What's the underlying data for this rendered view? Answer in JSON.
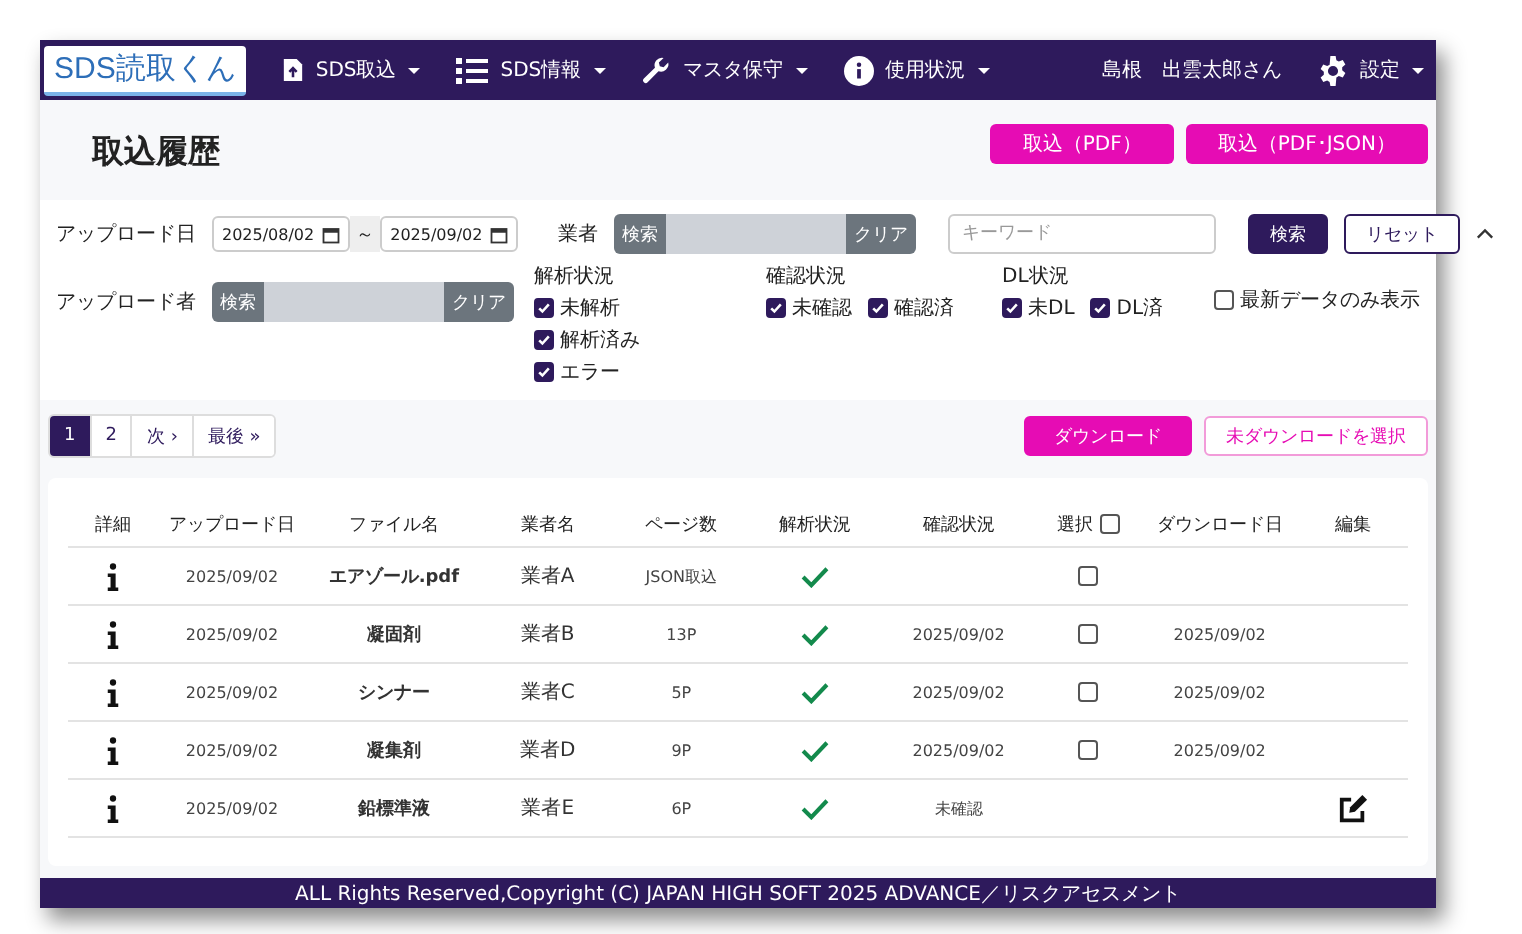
{
  "nav": {
    "logo": "SDS読取くん",
    "menus": [
      {
        "label": "SDS取込"
      },
      {
        "label": "SDS情報"
      },
      {
        "label": "マスタ保守"
      },
      {
        "label": "使用状況"
      }
    ],
    "user": "島根　出雲太郎さん",
    "settings": "設定"
  },
  "page": {
    "title": "取込履歴",
    "buttons": [
      "取込（PDF）",
      "取込（PDF･JSON）"
    ]
  },
  "filters": {
    "upload_date": {
      "label": "アップロード日",
      "from": "2025/08/02",
      "separator": "～",
      "to": "2025/09/02"
    },
    "uploader": {
      "label": "アップロード者",
      "search": "検索",
      "clear": "クリア"
    },
    "vendor": {
      "label": "業者",
      "search": "検索",
      "clear": "クリア"
    },
    "keyword": {
      "placeholder": "キーワード"
    },
    "search": "検索",
    "reset": "リセット",
    "groups": [
      {
        "title": "解析状況",
        "options": [
          {
            "label": "未解析",
            "checked": true
          },
          {
            "label": "解析済み",
            "checked": true
          },
          {
            "label": "エラー",
            "checked": true
          }
        ]
      },
      {
        "title": "確認状況",
        "options": [
          {
            "label": "未確認",
            "checked": true
          },
          {
            "label": "確認済",
            "checked": true
          }
        ]
      },
      {
        "title": "DL状況",
        "options": [
          {
            "label": "未DL",
            "checked": true
          },
          {
            "label": "DL済",
            "checked": true
          }
        ]
      }
    ],
    "latest_only": {
      "label": "最新データのみ表示",
      "checked": false
    }
  },
  "pagination": {
    "pages": [
      {
        "label": "1",
        "selected": true
      },
      {
        "label": "2",
        "selected": false
      }
    ],
    "next": "次 ›",
    "last": "最後 »"
  },
  "actions": [
    "ダウンロード",
    "未ダウンロードを選択"
  ],
  "table": {
    "columns": [
      "詳細",
      "アップロード日",
      "ファイル名",
      "業者名",
      "ページ数",
      "解析状況",
      "確認状況",
      "選択",
      "ダウンロード日",
      "編集"
    ],
    "select_all": false,
    "rows": [
      {
        "upload_date": "2025/09/02",
        "file": "エアゾール.pdf",
        "vendor": "業者A",
        "pages": "JSON取込",
        "analyzed": true,
        "select": {
          "checked": false
        },
        "editable": false
      },
      {
        "upload_date": "2025/09/02",
        "file": "凝固剤",
        "vendor": "業者B",
        "pages": "13P",
        "analyzed": true,
        "confirmation": "2025/09/02",
        "select": {
          "checked": false
        },
        "download_date": "2025/09/02",
        "editable": false
      },
      {
        "upload_date": "2025/09/02",
        "file": "シンナー",
        "vendor": "業者C",
        "pages": "5P",
        "analyzed": true,
        "confirmation": "2025/09/02",
        "select": {
          "checked": false
        },
        "download_date": "2025/09/02",
        "editable": false
      },
      {
        "upload_date": "2025/09/02",
        "file": "凝集剤",
        "vendor": "業者D",
        "pages": "9P",
        "analyzed": true,
        "confirmation": "2025/09/02",
        "select": {
          "checked": false
        },
        "download_date": "2025/09/02",
        "editable": false
      },
      {
        "upload_date": "2025/09/02",
        "file": "鉛標準液",
        "vendor": "業者E",
        "pages": "6P",
        "analyzed": true,
        "confirmation": "未確認",
        "editable": true
      }
    ]
  },
  "footer": "ALL Rights Reserved,Copyright (C) JAPAN HIGH SOFT 2025 ADVANCE／リスクアセスメント"
}
